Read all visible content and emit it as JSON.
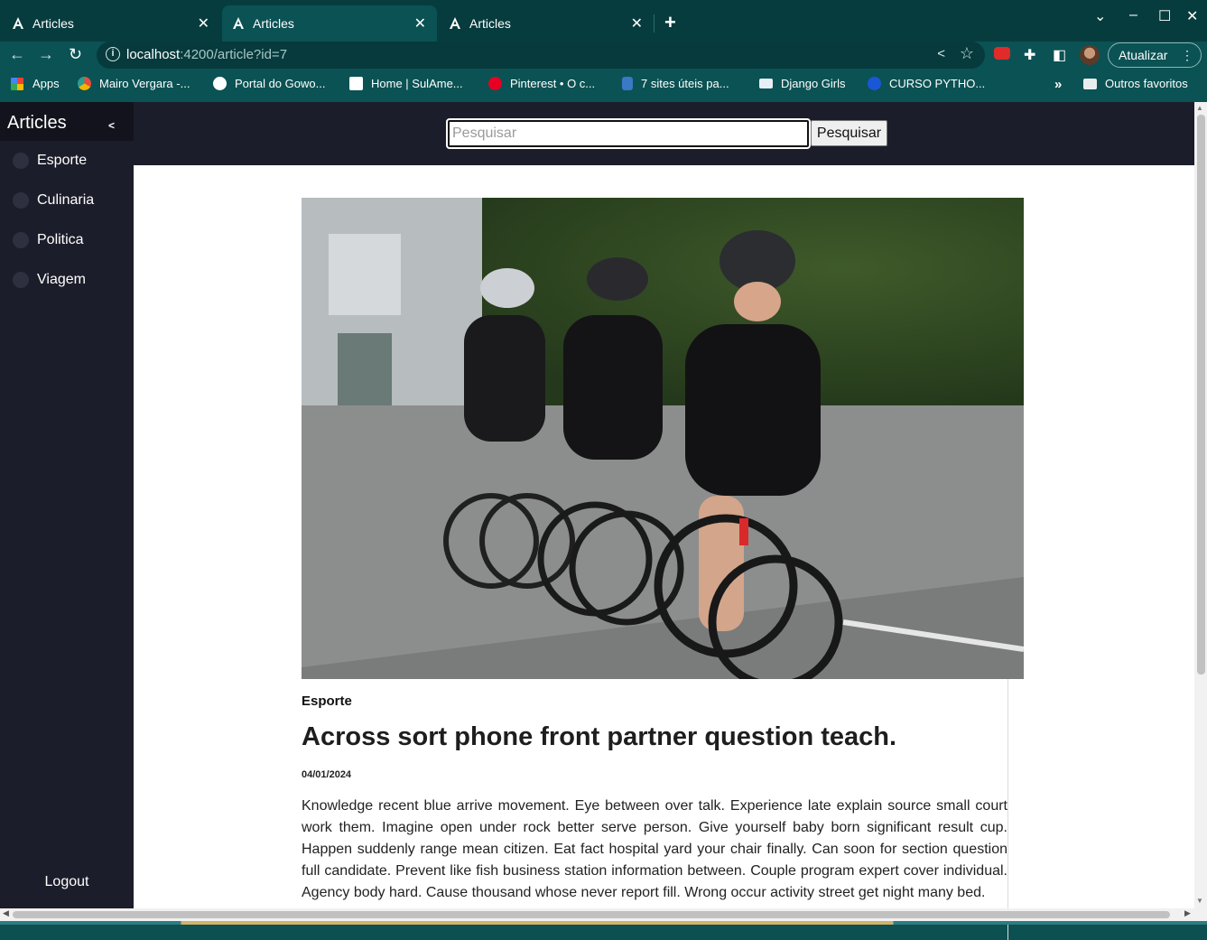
{
  "browser": {
    "tabs": [
      {
        "title": "Articles",
        "active": false
      },
      {
        "title": "Articles",
        "active": true
      },
      {
        "title": "Articles",
        "active": false
      }
    ],
    "url_host": "localhost",
    "url_rest": ":4200/article?id=7",
    "update_button": "Atualizar",
    "bookmarks": [
      {
        "label": "Apps",
        "icon": "apps-grid-icon"
      },
      {
        "label": "Mairo Vergara -...",
        "icon": "site-icon"
      },
      {
        "label": "Portal do Gowo...",
        "icon": "globe-icon"
      },
      {
        "label": "Home | SulAme...",
        "icon": "site-icon"
      },
      {
        "label": "Pinterest • O c...",
        "icon": "pinterest-icon"
      },
      {
        "label": "7 sites úteis pa...",
        "icon": "site-icon"
      },
      {
        "label": "Django Girls",
        "icon": "site-icon"
      },
      {
        "label": "CURSO PYTHO...",
        "icon": "site-icon"
      }
    ],
    "other_bookmarks": "Outros favoritos",
    "colors": {
      "frame": "#073c3e",
      "toolbar": "#0b5254"
    }
  },
  "sidebar": {
    "title": "Articles",
    "items": [
      {
        "label": "Esporte"
      },
      {
        "label": "Culinaria"
      },
      {
        "label": "Politica"
      },
      {
        "label": "Viagem"
      }
    ],
    "logout": "Logout",
    "colors": {
      "background": "#1c1d2a"
    }
  },
  "search": {
    "placeholder": "Pesquisar",
    "value": "",
    "button_label": "Pesquisar"
  },
  "article": {
    "category": "Esporte",
    "title": "Across sort phone front partner question teach.",
    "date": "04/01/2024",
    "content": "Knowledge recent blue arrive movement. Eye between over talk. Experience late explain source small court work them. Imagine open under rock better serve person. Give yourself baby born significant result cup. Happen suddenly range mean citizen. Eat fact hospital yard your chair finally. Can soon for section question full candidate. Prevent like fish business station information between. Couple program expert cover individual. Agency body hard. Cause thousand whose never report fill. Wrong occur activity street get night many bed."
  }
}
